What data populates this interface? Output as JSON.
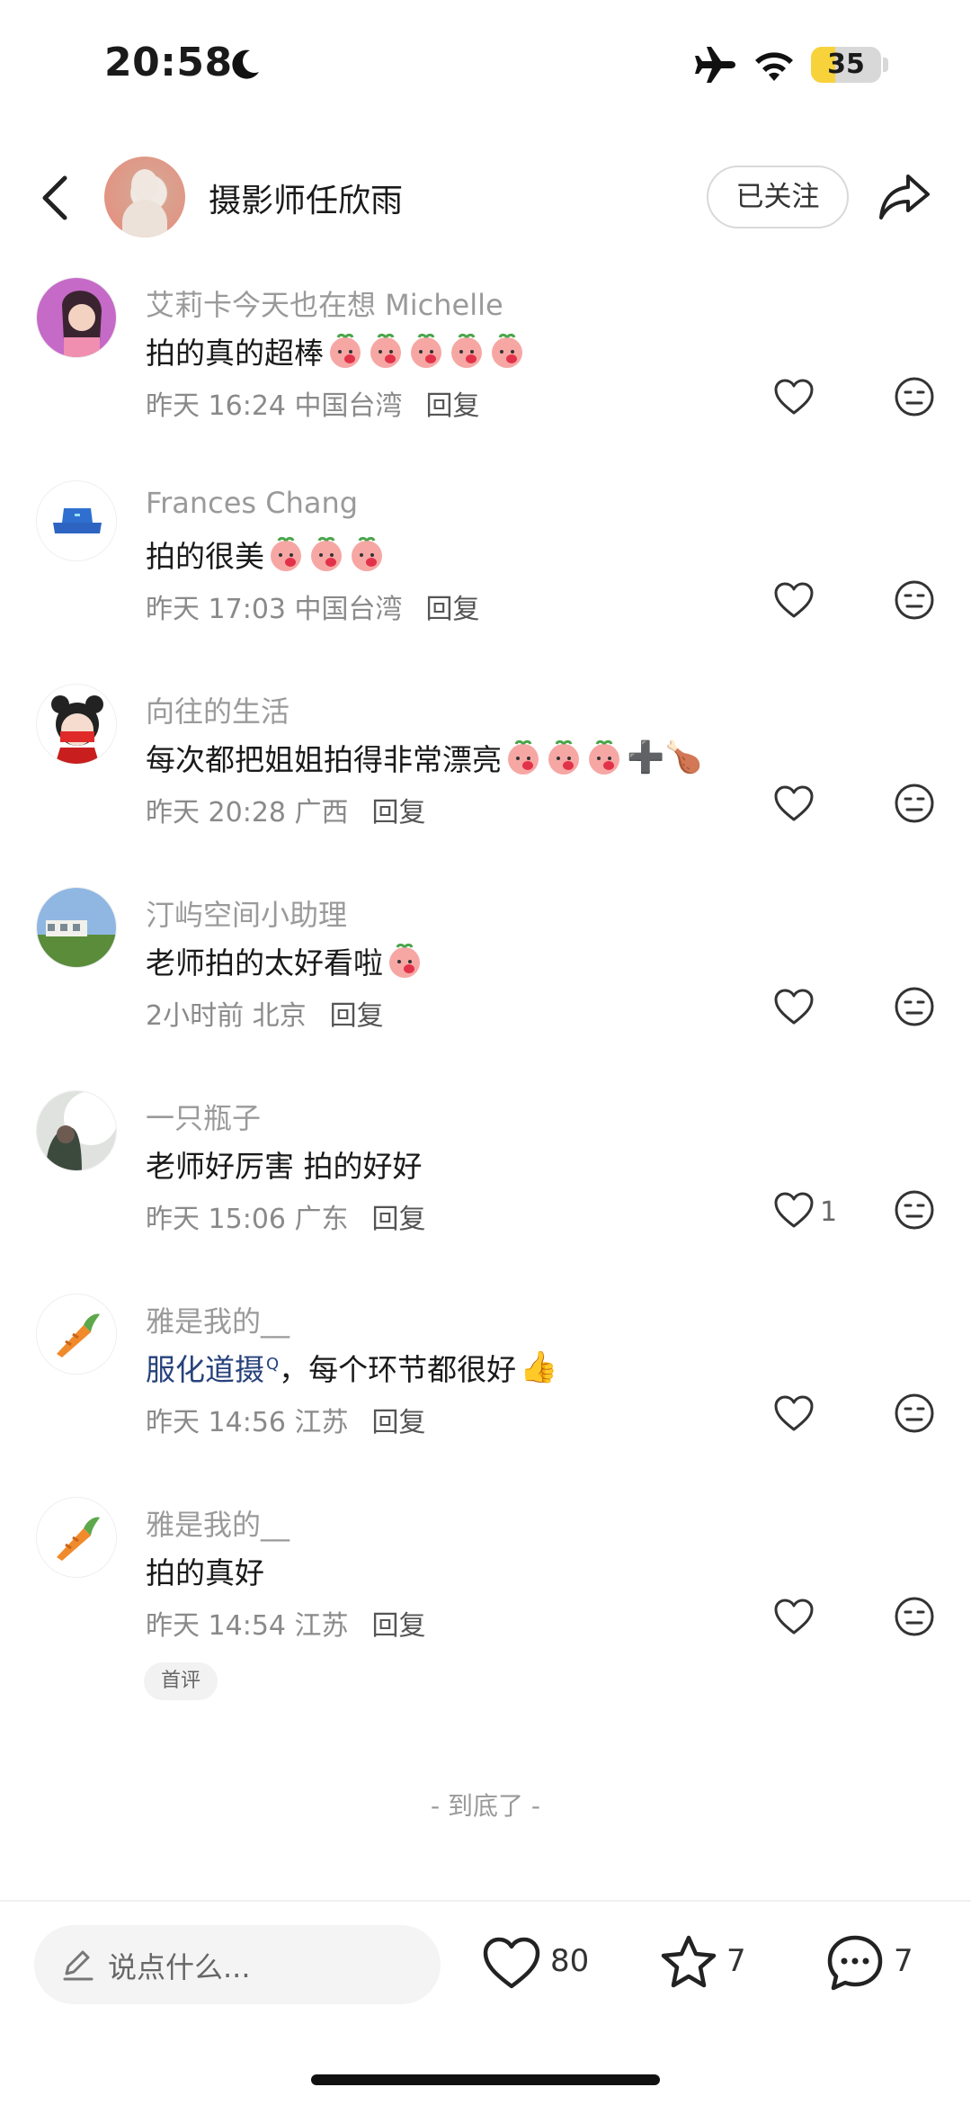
{
  "status_bar": {
    "time": "20:58",
    "battery": "35",
    "battery_level": 0.35
  },
  "header": {
    "author_name": "摄影师任欣雨",
    "follow_label": "已关注"
  },
  "comments": [
    {
      "name": "艾莉卡今天也在想 Michelle",
      "text": "拍的真的超棒",
      "emoji_count": 5,
      "date": "昨天 16:24",
      "location": "中国台湾",
      "reply": "回复",
      "likes": ""
    },
    {
      "name": "Frances Chang",
      "text": "拍的很美",
      "emoji_count": 3,
      "date": "昨天 17:03",
      "location": "中国台湾",
      "reply": "回复",
      "likes": ""
    },
    {
      "name": "向往的生活",
      "text": "每次都把姐姐拍得非常漂亮",
      "emoji_count": 3,
      "extra": "➕🍗",
      "date": "昨天 20:28",
      "location": "广西",
      "reply": "回复",
      "likes": ""
    },
    {
      "name": "汀屿空间小助理",
      "text": "老师拍的太好看啦",
      "emoji_count": 1,
      "date": "2小时前",
      "location": "北京",
      "reply": "回复",
      "likes": ""
    },
    {
      "name": "一只瓶子",
      "text": "老师好厉害 拍的好好",
      "emoji_count": 0,
      "date": "昨天 15:06",
      "location": "广东",
      "reply": "回复",
      "likes": "1"
    },
    {
      "name": "雅是我的__",
      "link_text": "服化道摄",
      "text": "，每个环节都很好",
      "extra": "👍",
      "date": "昨天 14:56",
      "location": "江苏",
      "reply": "回复",
      "likes": ""
    },
    {
      "name": "雅是我的__",
      "text": "拍的真好",
      "emoji_count": 0,
      "date": "昨天 14:54",
      "location": "江苏",
      "reply": "回复",
      "likes": "",
      "badge": "首评"
    }
  ],
  "end_text": "- 到底了 -",
  "bottom_bar": {
    "placeholder": "说点什么...",
    "likes": "80",
    "stars": "7",
    "comments": "7"
  },
  "icons": [
    "moon-icon",
    "airplane-icon",
    "wifi-icon",
    "back-icon",
    "share-icon",
    "heart-icon",
    "dislike-icon",
    "pen-icon",
    "star-icon",
    "chat-icon",
    "peach-emoji-icon"
  ]
}
